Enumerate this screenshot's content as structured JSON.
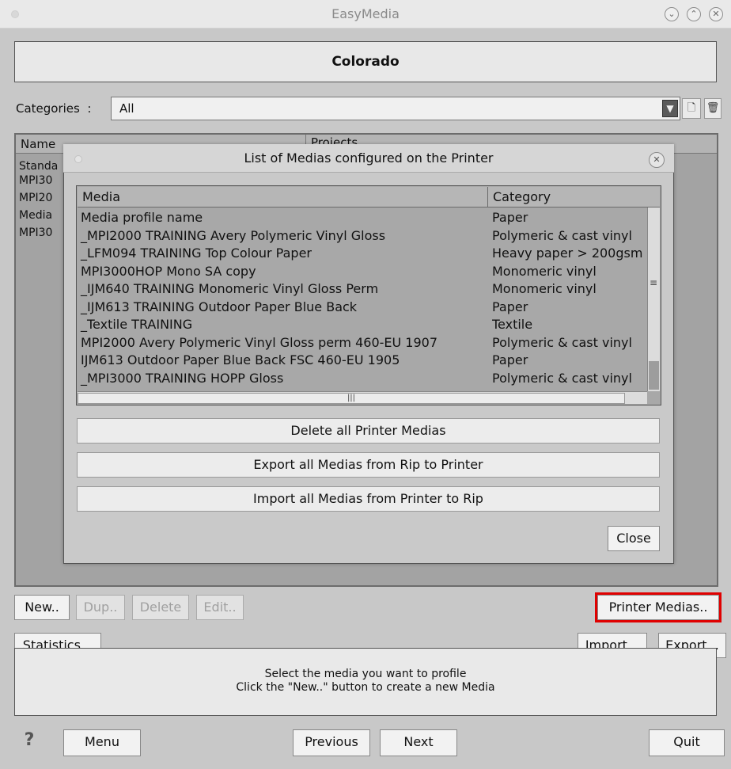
{
  "window": {
    "title": "EasyMedia",
    "controls": [
      "minimize",
      "maximize",
      "close"
    ]
  },
  "header": {
    "title": "Colorado"
  },
  "categories": {
    "label": "Categories",
    "separator": ":",
    "selected": "All"
  },
  "background_list": {
    "columns": [
      "Name",
      "Projects"
    ],
    "rows": [
      "Standa",
      "MPI30",
      "MPI20",
      "Media",
      "MPI30"
    ]
  },
  "dialog": {
    "title": "List of Medias configured on the Printer",
    "table": {
      "columns": [
        "Media",
        "Category"
      ],
      "rows": [
        {
          "media": "Media profile name",
          "category": "Paper"
        },
        {
          "media": "_MPI2000 TRAINING Avery Polymeric Vinyl Gloss",
          "category": "Polymeric & cast vinyl"
        },
        {
          "media": "_LFM094 TRAINING Top Colour Paper",
          "category": "Heavy paper > 200gsm"
        },
        {
          "media": "MPI3000HOP Mono SA copy",
          "category": "Monomeric vinyl"
        },
        {
          "media": "_IJM640 TRAINING Monomeric Vinyl Gloss Perm",
          "category": "Monomeric vinyl"
        },
        {
          "media": "_IJM613 TRAINING Outdoor Paper Blue Back",
          "category": "Paper"
        },
        {
          "media": "_Textile TRAINING",
          "category": "Textile"
        },
        {
          "media": "MPI2000 Avery Polymeric Vinyl Gloss perm 460-EU 1907",
          "category": "Polymeric & cast vinyl"
        },
        {
          "media": "IJM613 Outdoor Paper Blue Back  FSC 460-EU 1905",
          "category": "Paper"
        },
        {
          "media": "_MPI3000 TRAINING HOPP Gloss",
          "category": "Polymeric & cast vinyl"
        }
      ]
    },
    "buttons": {
      "delete_all": "Delete all Printer Medias",
      "export_all": "Export all Medias from Rip to Printer",
      "import_all": "Import all Medias from Printer to Rip",
      "close": "Close"
    }
  },
  "actions": {
    "new": "New..",
    "dup": "Dup..",
    "delete": "Delete",
    "edit": "Edit..",
    "printer_medias": "Printer Medias..",
    "statistics": "Statistics...",
    "import": "Import...",
    "export": "Export..."
  },
  "status": {
    "line1": "Select the media you want to profile",
    "line2": "Click the \"New..\" button to create a new Media"
  },
  "nav": {
    "help": "?",
    "menu": "Menu",
    "previous": "Previous",
    "next": "Next",
    "quit": "Quit"
  },
  "colors": {
    "highlight": "#e00000",
    "panel_bg": "#a3a3a3",
    "window_bg": "#c8c8c8"
  }
}
